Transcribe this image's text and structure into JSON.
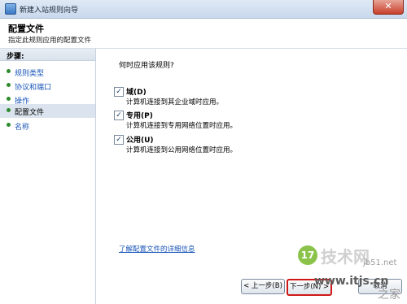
{
  "window": {
    "title": "新建入站规则向导",
    "close_glyph": "✕"
  },
  "header": {
    "title": "配置文件",
    "subtitle": "指定此规则应用的配置文件"
  },
  "steps": {
    "heading": "步骤:",
    "items": [
      {
        "label": "规则类型"
      },
      {
        "label": "协议和端口"
      },
      {
        "label": "操作"
      },
      {
        "label": "配置文件"
      },
      {
        "label": "名称"
      }
    ]
  },
  "main": {
    "question": "何时应用该规则?",
    "options": [
      {
        "label": "域(D)",
        "description": "计算机连接到其企业域时应用。",
        "checked": true
      },
      {
        "label": "专用(P)",
        "description": "计算机连接到专用网络位置时应用。",
        "checked": true
      },
      {
        "label": "公用(U)",
        "description": "计算机连接到公用网络位置时应用。",
        "checked": true
      }
    ],
    "learn_more": "了解配置文件的详细信息"
  },
  "buttons": {
    "back": "< 上一步(B)",
    "next": "下一步(N) >",
    "cancel": "取消"
  },
  "watermark": {
    "badge": "17",
    "line1": "技术网",
    "line2": "www.itjs.cn",
    "line3": "jb51.net",
    "line4": "之家"
  },
  "colors": {
    "step_bullet": "#2e8b2e",
    "link": "#1a56b8",
    "highlight_border": "#d01818"
  }
}
